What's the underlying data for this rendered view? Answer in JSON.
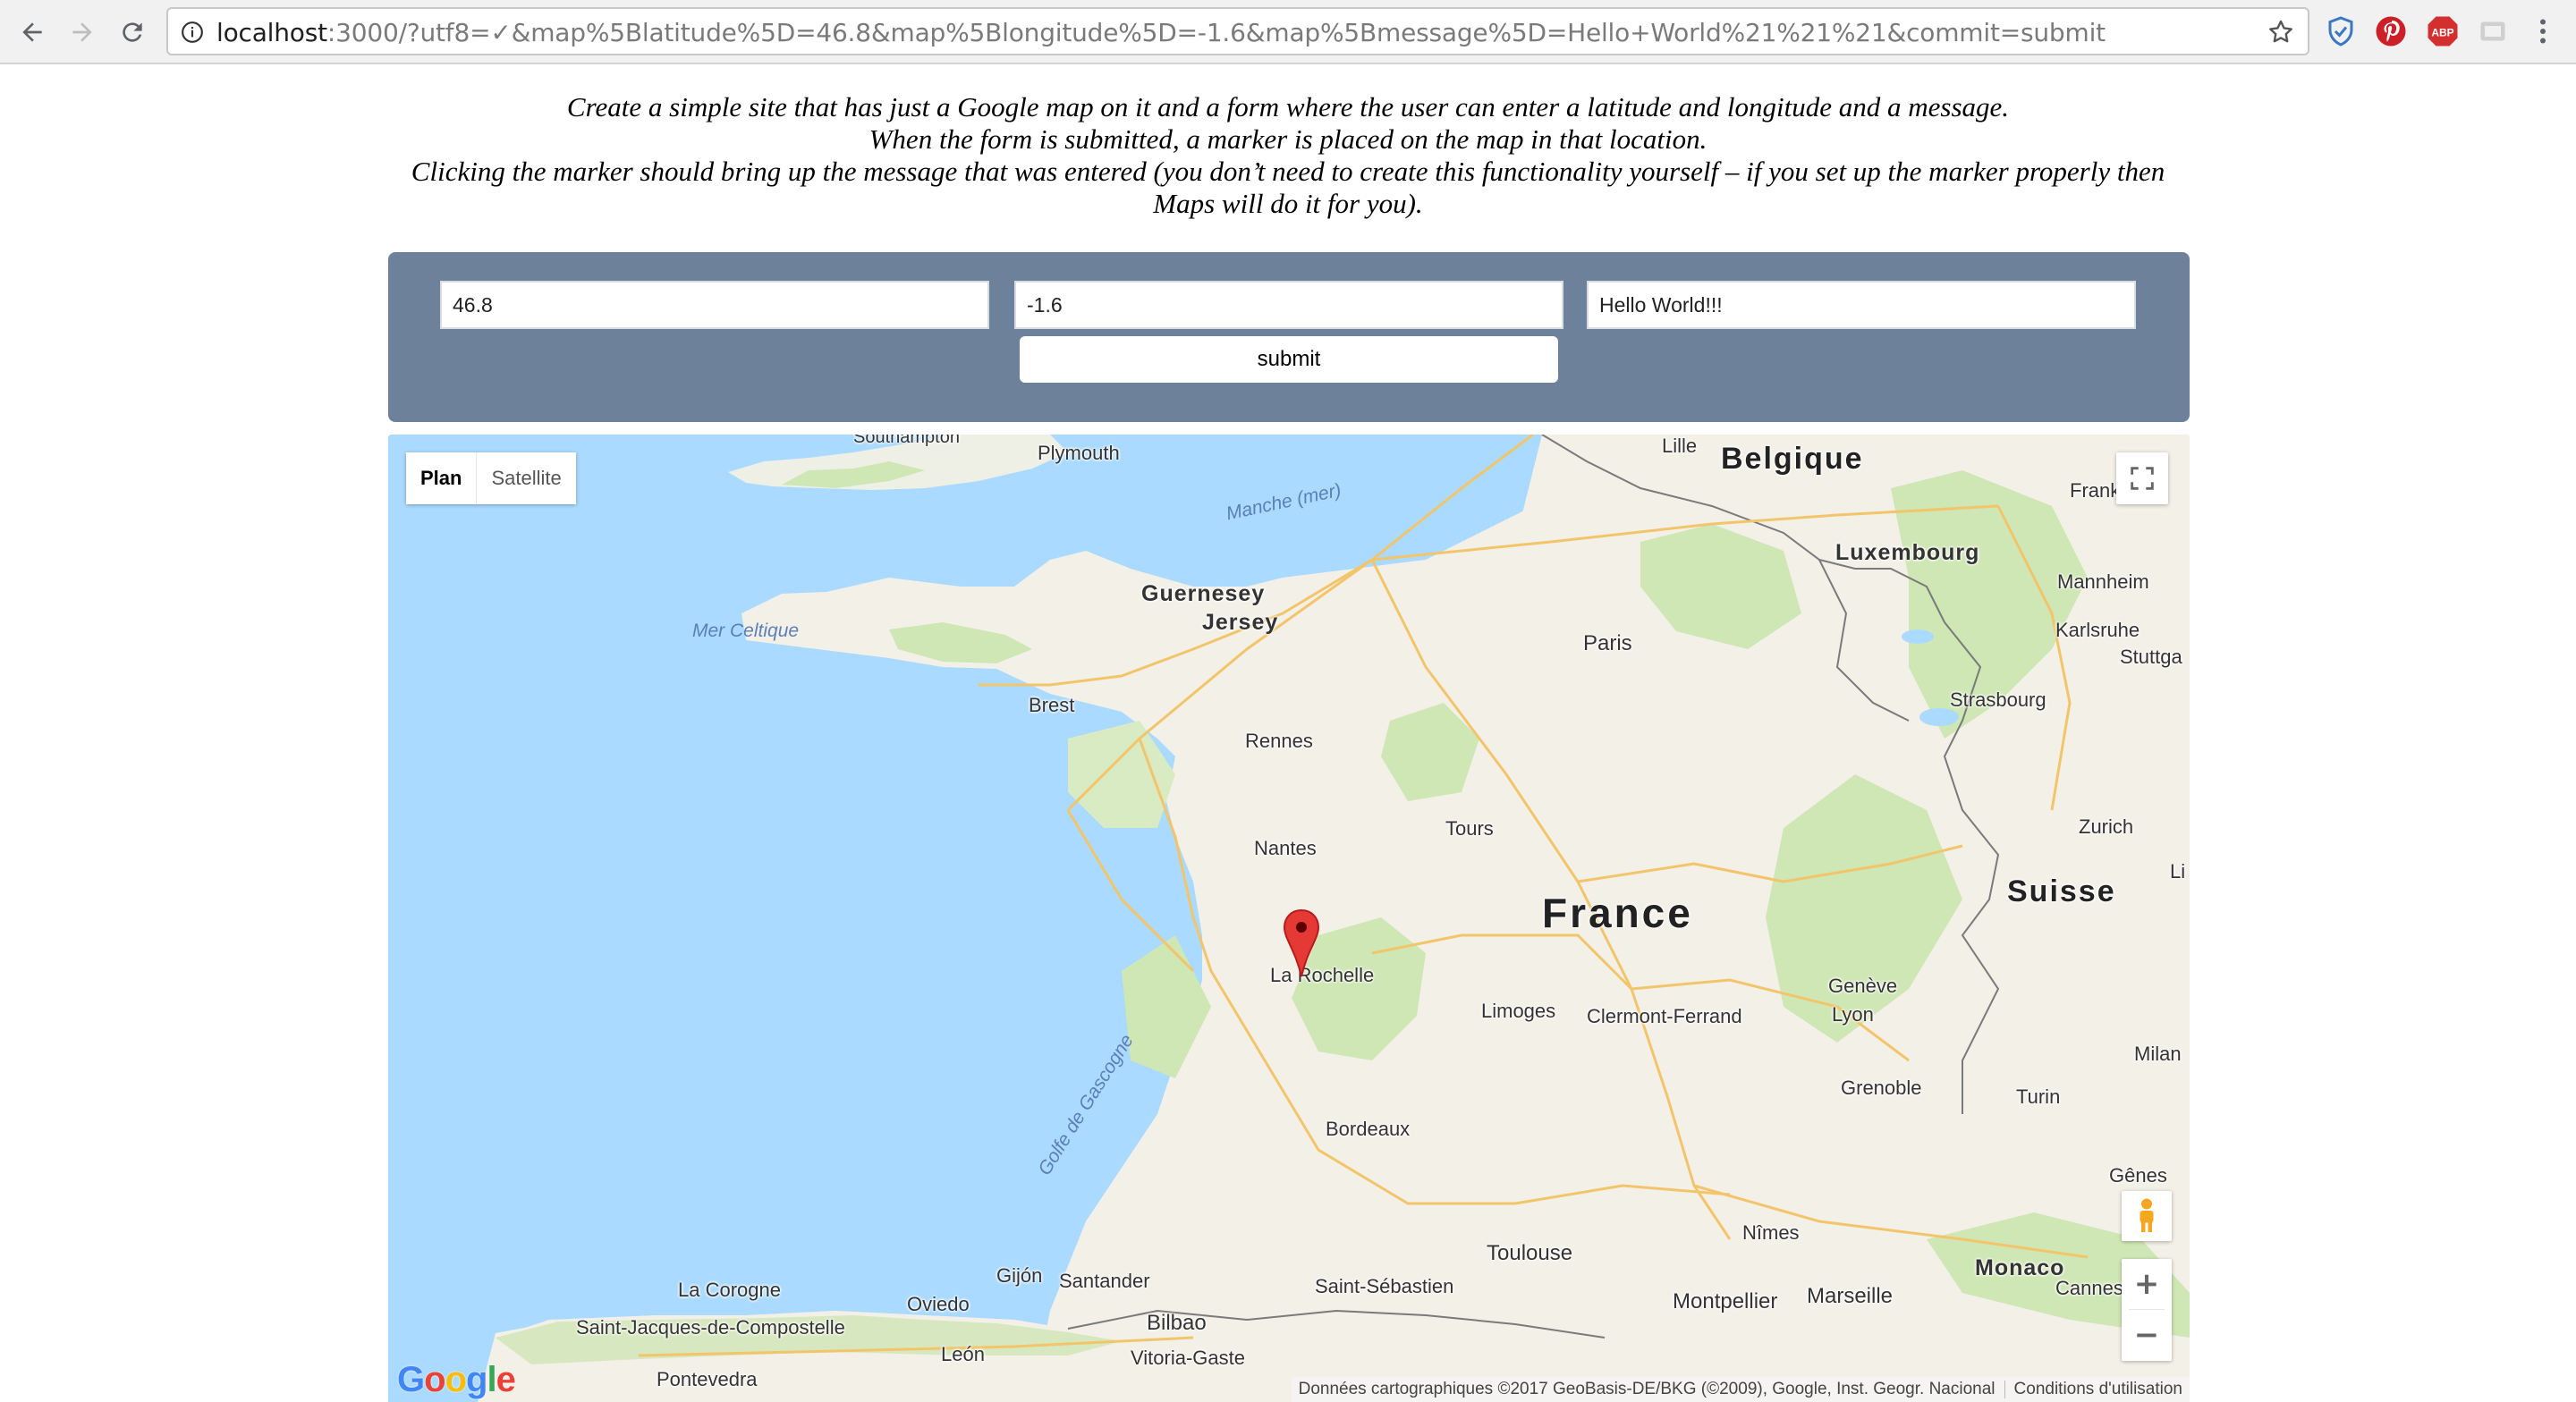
{
  "browser": {
    "url_host": "localhost",
    "url_rest": ":3000/?utf8=✓&map%5Blatitude%5D=46.8&map%5Blongitude%5D=-1.6&map%5Bmessage%5D=Hello+World%21%21%21&commit=submit",
    "icons": [
      "back-icon",
      "forward-icon",
      "reload-icon",
      "info-icon",
      "star-icon",
      "shield-extension-icon",
      "pinterest-icon",
      "adblock-icon",
      "cast-icon",
      "menu-icon"
    ],
    "adblock_label": "ABP"
  },
  "intro": {
    "line1": "Create a simple site that has just a Google map on it and a form where the user can enter a latitude and longitude and a message.",
    "line2": "When the form is submitted, a marker is placed on the map in that location.",
    "line3": "Clicking the marker should bring up the message that was entered (you don’t need to create this functionality yourself – if you set up the marker properly then Maps will do it for you)."
  },
  "form": {
    "latitude": "46.8",
    "longitude": "-1.6",
    "message": "Hello World!!!",
    "submit_label": "submit",
    "panel_color": "#6e819a"
  },
  "map": {
    "type_buttons": {
      "plan": "Plan",
      "satellite": "Satellite"
    },
    "active_type": "Plan",
    "zoom_in": "+",
    "zoom_out": "−",
    "google_logo": "Google",
    "attribution": "Données cartographiques ©2017 GeoBasis-DE/BKG (©2009), Google, Inst. Geogr. Nacional",
    "terms": "Conditions d'utilisation",
    "water_color": "#aadaff",
    "land_color": "#f3f0e8",
    "marker_color": "#e53935",
    "labels": {
      "belgique": "Belgique",
      "luxembourg": "Luxembourg",
      "france": "France",
      "suisse": "Suisse",
      "plymouth": "Plymouth",
      "southampton": "Southampton",
      "lille": "Lille",
      "frankfurt": "Frankfurt",
      "manche": "Manche (mer)",
      "guernesey": "Guernesey",
      "jersey": "Jersey",
      "mer_celtique": "Mer Celtique",
      "paris": "Paris",
      "mannheim": "Mannheim",
      "karlsruhe": "Karlsruhe",
      "stuttgart": "Stuttga",
      "brest": "Brest",
      "rennes": "Rennes",
      "strasbourg": "Strasbourg",
      "tours": "Tours",
      "nantes": "Nantes",
      "zurich": "Zurich",
      "li": "Li",
      "la_rochelle": "La Rochelle",
      "geneve": "Genève",
      "limoges": "Limoges",
      "clermont": "Clermont-Ferrand",
      "lyon": "Lyon",
      "milan": "Milan",
      "golfe": "Golfe de Gascogne",
      "grenoble": "Grenoble",
      "turin": "Turin",
      "bordeaux": "Bordeaux",
      "genes": "Gênes",
      "nimes": "Nîmes",
      "toulouse": "Toulouse",
      "monaco": "Monaco",
      "montpellier": "Montpellier",
      "marseille": "Marseille",
      "cannes": "Cannes",
      "gijon": "Gijón",
      "la_corogne": "La Corogne",
      "santander": "Santander",
      "saint_sebastien": "Saint-Sébastien",
      "oviedo": "Oviedo",
      "bilbao": "Bilbao",
      "saint_jacques": "Saint-Jacques-de-Compostelle",
      "leon": "León",
      "vitoria": "Vitoria-Gaste",
      "pontevedra": "Pontevedra"
    }
  }
}
